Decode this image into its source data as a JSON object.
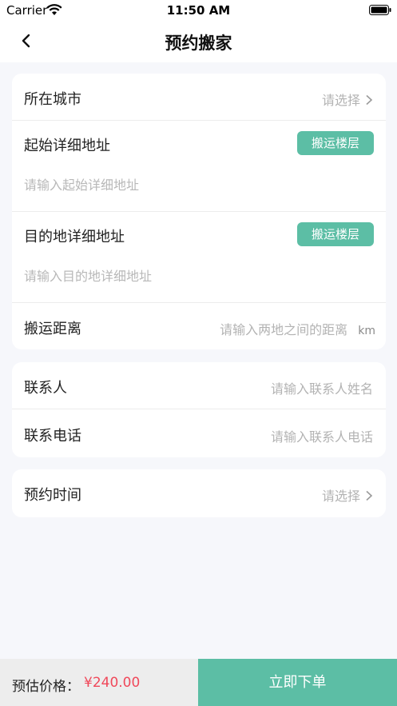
{
  "status_bar": {
    "carrier": "Carrier",
    "time": "11:50 AM"
  },
  "nav": {
    "title": "预约搬家"
  },
  "address_card": {
    "city": {
      "label": "所在城市",
      "value": "请选择"
    },
    "start": {
      "label": "起始详细地址",
      "button": "搬运楼层",
      "placeholder": "请输入起始详细地址"
    },
    "dest": {
      "label": "目的地详细地址",
      "button": "搬运楼层",
      "placeholder": "请输入目的地详细地址"
    },
    "distance": {
      "label": "搬运距离",
      "placeholder": "请输入两地之间的距离",
      "unit": "km"
    }
  },
  "contact_card": {
    "name": {
      "label": "联系人",
      "placeholder": "请输入联系人姓名"
    },
    "phone": {
      "label": "联系电话",
      "placeholder": "请输入联系人电话"
    }
  },
  "time_card": {
    "label": "预约时间",
    "value": "请选择"
  },
  "bottom": {
    "price_label": "预估价格：",
    "price_value": "¥240.00",
    "submit": "立即下单"
  },
  "colors": {
    "accent": "#5cbea5",
    "price": "#f0485a",
    "background": "#f6f7fb"
  }
}
